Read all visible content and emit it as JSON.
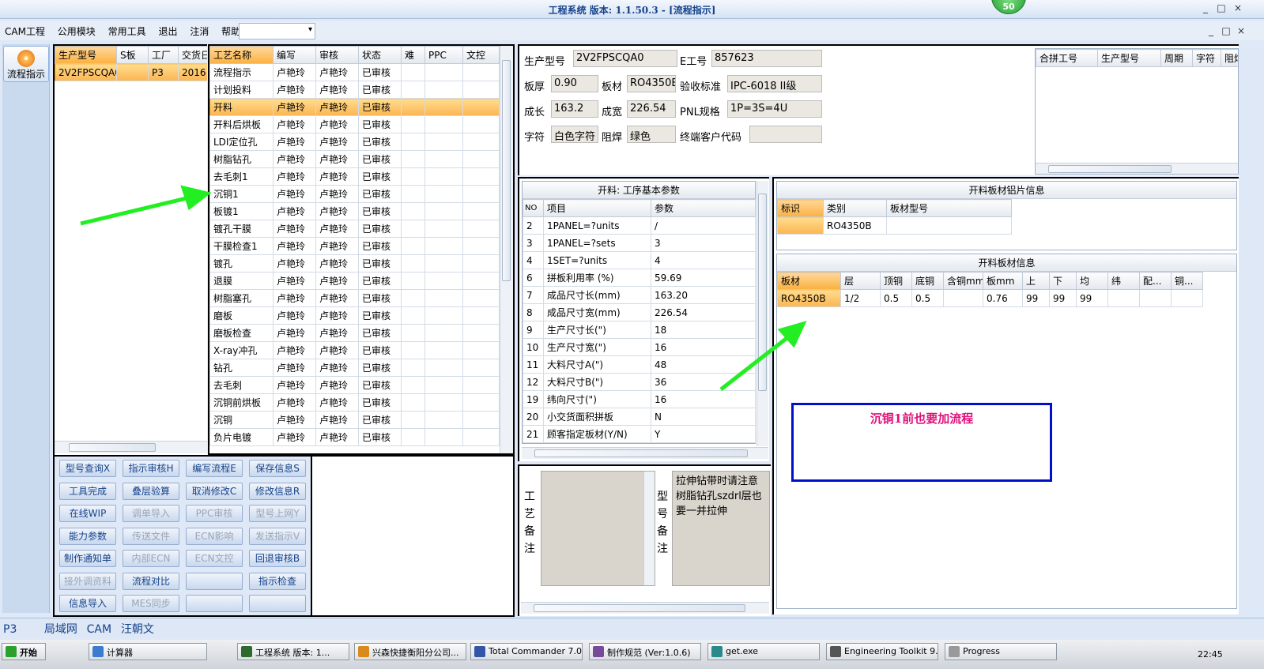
{
  "window": {
    "title": "工程系统  版本: 1.1.50.3 - [流程指示]",
    "badge": "50",
    "mdi_controls": [
      "_",
      "□",
      "×"
    ],
    "controls": [
      "_",
      "□",
      "×"
    ]
  },
  "menu": {
    "items": [
      "CAM工程",
      "公用模块",
      "常用工具",
      "退出",
      "注消",
      "帮助"
    ],
    "dropdown_caret": "▾"
  },
  "nav": {
    "label": "流程指示"
  },
  "models": {
    "columns": [
      "生产型号",
      "S板",
      "工厂",
      "交货日"
    ],
    "rows": [
      [
        "2V2FPSCQA0",
        "",
        "P3",
        "2016"
      ]
    ]
  },
  "flow": {
    "columns": [
      "工艺名称",
      "编写",
      "审核",
      "状态",
      "难",
      "PPC",
      "文控"
    ],
    "selected_index": 2,
    "rows": [
      [
        "流程指示",
        "卢艳玲",
        "卢艳玲",
        "已审核"
      ],
      [
        "计划投料",
        "卢艳玲",
        "卢艳玲",
        "已审核"
      ],
      [
        "开料",
        "卢艳玲",
        "卢艳玲",
        "已审核"
      ],
      [
        "开料后烘板",
        "卢艳玲",
        "卢艳玲",
        "已审核"
      ],
      [
        "LDI定位孔",
        "卢艳玲",
        "卢艳玲",
        "已审核"
      ],
      [
        "树脂钻孔",
        "卢艳玲",
        "卢艳玲",
        "已审核"
      ],
      [
        "去毛刺1",
        "卢艳玲",
        "卢艳玲",
        "已审核"
      ],
      [
        "沉铜1",
        "卢艳玲",
        "卢艳玲",
        "已审核"
      ],
      [
        "板镀1",
        "卢艳玲",
        "卢艳玲",
        "已审核"
      ],
      [
        "镀孔干膜",
        "卢艳玲",
        "卢艳玲",
        "已审核"
      ],
      [
        "干膜检查1",
        "卢艳玲",
        "卢艳玲",
        "已审核"
      ],
      [
        "镀孔",
        "卢艳玲",
        "卢艳玲",
        "已审核"
      ],
      [
        "退膜",
        "卢艳玲",
        "卢艳玲",
        "已审核"
      ],
      [
        "树脂塞孔",
        "卢艳玲",
        "卢艳玲",
        "已审核"
      ],
      [
        "磨板",
        "卢艳玲",
        "卢艳玲",
        "已审核"
      ],
      [
        "磨板检查",
        "卢艳玲",
        "卢艳玲",
        "已审核"
      ],
      [
        "X-ray冲孔",
        "卢艳玲",
        "卢艳玲",
        "已审核"
      ],
      [
        "钻孔",
        "卢艳玲",
        "卢艳玲",
        "已审核"
      ],
      [
        "去毛刺",
        "卢艳玲",
        "卢艳玲",
        "已审核"
      ],
      [
        "沉铜前烘板",
        "卢艳玲",
        "卢艳玲",
        "已审核"
      ],
      [
        "沉铜",
        "卢艳玲",
        "卢艳玲",
        "已审核"
      ],
      [
        "负片电镀",
        "卢艳玲",
        "卢艳玲",
        "已审核"
      ]
    ]
  },
  "buttons": [
    [
      {
        "label": "型号查询X",
        "enabled": true
      },
      {
        "label": "指示审核H",
        "enabled": true
      },
      {
        "label": "编写流程E",
        "enabled": true
      },
      {
        "label": "保存信息S",
        "enabled": true
      }
    ],
    [
      {
        "label": "工具完成",
        "enabled": true
      },
      {
        "label": "叠层验算",
        "enabled": true
      },
      {
        "label": "取消修改C",
        "enabled": true
      },
      {
        "label": "修改信息R",
        "enabled": true
      }
    ],
    [
      {
        "label": "在线WIP",
        "enabled": true
      },
      {
        "label": "调单导入",
        "enabled": false
      },
      {
        "label": "PPC审核",
        "enabled": false
      },
      {
        "label": "型号上网Y",
        "enabled": false
      }
    ],
    [
      {
        "label": "能力参数",
        "enabled": true
      },
      {
        "label": "传送文件",
        "enabled": false
      },
      {
        "label": "ECN影响",
        "enabled": false
      },
      {
        "label": "发送指示V",
        "enabled": false
      }
    ],
    [
      {
        "label": "制作通知单",
        "enabled": true
      },
      {
        "label": "内部ECN",
        "enabled": false
      },
      {
        "label": "ECN文控",
        "enabled": false
      },
      {
        "label": "回退审核B",
        "enabled": true
      }
    ],
    [
      {
        "label": "接外调资料",
        "enabled": false
      },
      {
        "label": "流程对比",
        "enabled": true
      },
      {
        "label": "",
        "enabled": true
      },
      {
        "label": "指示检查",
        "enabled": true
      }
    ],
    [
      {
        "label": "信息导入",
        "enabled": true
      },
      {
        "label": "MES同步",
        "enabled": false
      },
      {
        "label": "",
        "enabled": true
      },
      {
        "label": "",
        "enabled": true
      }
    ]
  ],
  "info": {
    "model_label": "生产型号",
    "model_value": "2V2FPSCQA0",
    "eno_label": "E工号",
    "eno_value": "857623",
    "thick_label": "板厚",
    "thick_value": "0.90",
    "material_label": "板材",
    "material_value": "RO4350B",
    "accept_label": "验收标准",
    "accept_value": "IPC-6018 II级",
    "len_label": "成长",
    "len_value": "163.2",
    "wid_label": "成宽",
    "wid_value": "226.54",
    "pnl_label": "PNL规格",
    "pnl_value": "1P=3S=4U",
    "char_label": "字符",
    "char_value": "白色字符",
    "mask_label": "阻焊",
    "mask_value": "绿色",
    "cust_label": "终端客户代码",
    "cust_value": ""
  },
  "merge": {
    "columns": [
      "合拼工号",
      "生产型号",
      "周期",
      "字符",
      "阻焊"
    ]
  },
  "params": {
    "caption": "开料: 工序基本参数",
    "columns": [
      "NO",
      "项目",
      "参数"
    ],
    "rows": [
      [
        "2",
        "1PANEL=?units",
        "/"
      ],
      [
        "3",
        "1PANEL=?sets",
        "3"
      ],
      [
        "4",
        "1SET=?units",
        "4"
      ],
      [
        "6",
        "拼板利用率 (%)",
        "59.69"
      ],
      [
        "7",
        "成品尺寸长(mm)",
        "163.20"
      ],
      [
        "8",
        "成品尺寸宽(mm)",
        "226.54"
      ],
      [
        "9",
        "生产尺寸长(\")",
        "18"
      ],
      [
        "10",
        "生产尺寸宽(\")",
        "16"
      ],
      [
        "11",
        "大料尺寸A(\")",
        "48"
      ],
      [
        "12",
        "大料尺寸B(\")",
        "36"
      ],
      [
        "19",
        "纬向尺寸(\")",
        "16"
      ],
      [
        "20",
        "小交货面积拼板",
        "N"
      ],
      [
        "21",
        "顾客指定板材(Y/N)",
        "Y"
      ]
    ]
  },
  "foil": {
    "caption": "开料板材铝片信息",
    "columns": [
      "标识",
      "类别",
      "板材型号"
    ],
    "rows": [
      [
        "",
        "RO4350B",
        ""
      ]
    ]
  },
  "board": {
    "caption": "开料板材信息",
    "columns": [
      "板材",
      "层",
      "顶铜",
      "底铜",
      "含铜mm",
      "板mm",
      "上",
      "下",
      "均",
      "纬",
      "配...",
      "铜..."
    ],
    "rows": [
      [
        "RO4350B",
        "1/2",
        "0.5",
        "0.5",
        "",
        "0.76",
        "99",
        "99",
        "99",
        "",
        "",
        ""
      ]
    ]
  },
  "note_box": {
    "text": "沉铜1前也要加流程",
    "color": "#e0107a"
  },
  "remarks": {
    "process_label": "工艺备注",
    "model_label": "型号备注",
    "model_text": "拉伸钻带时请注意树脂钻孔szdrl层也要一并拉伸"
  },
  "status": {
    "factory": "P3",
    "tabs": [
      "局域网",
      "CAM",
      "汪朝文"
    ]
  },
  "taskbar": {
    "start": "开始",
    "tasks": [
      "计算器",
      "工程系统 版本: 1...",
      "兴森快捷衡阳分公司...",
      "Total Commander 7.0 ...",
      "制作规范 (Ver:1.0.6)",
      "get.exe",
      "Engineering Toolkit 9.0...",
      "Progress"
    ],
    "clock": "22:45"
  },
  "colors": {
    "accent": "#15428b",
    "selection": "#fbb552",
    "arrow": "#22ee22",
    "note_border": "#0010c8"
  }
}
